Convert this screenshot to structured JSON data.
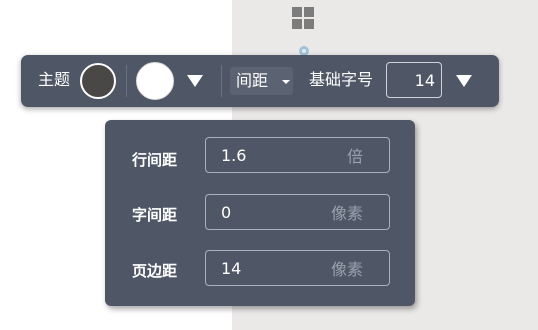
{
  "toolbar": {
    "theme_label": "主题",
    "spacing_label": "间距",
    "base_font_label": "基础字号",
    "base_font_value": "14",
    "theme_color": "#4a4747",
    "palette_color": "#ffffff"
  },
  "spacing_panel": {
    "rows": [
      {
        "label": "行间距",
        "value": "1.6",
        "unit": "倍"
      },
      {
        "label": "字间距",
        "value": "0",
        "unit": "像素"
      },
      {
        "label": "页边距",
        "value": "14",
        "unit": "像素"
      }
    ]
  }
}
